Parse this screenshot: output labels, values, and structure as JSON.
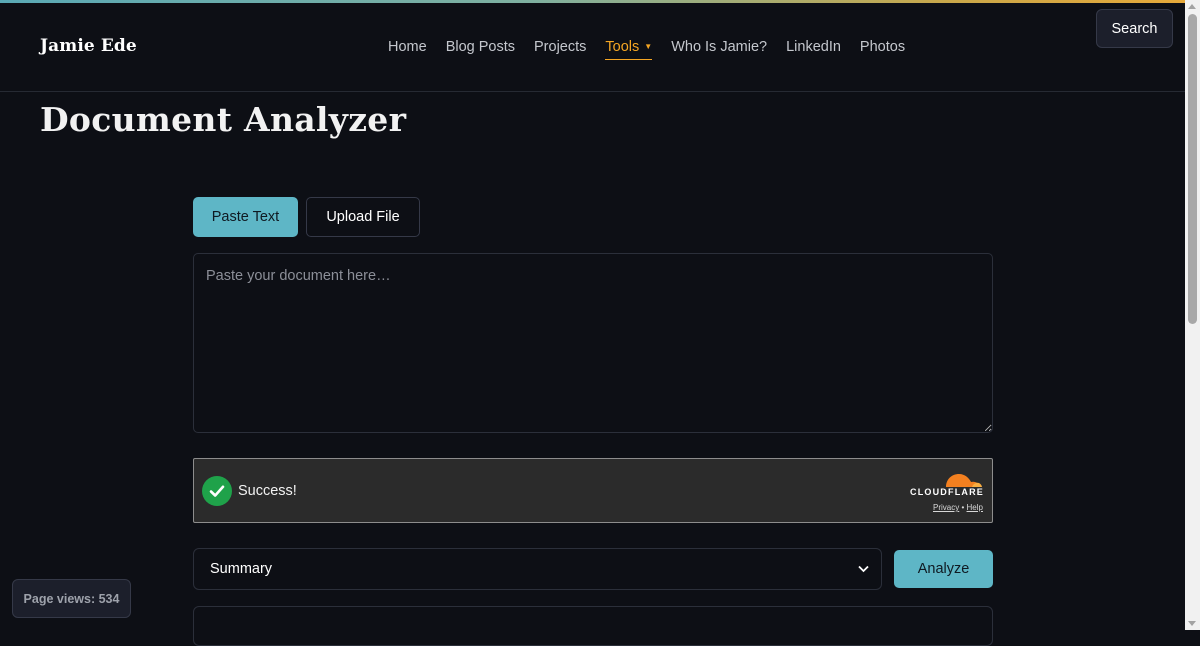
{
  "site": {
    "brand": "Jamie Ede",
    "nav": [
      {
        "label": "Home"
      },
      {
        "label": "Blog Posts"
      },
      {
        "label": "Projects"
      },
      {
        "label": "Tools",
        "active": true
      },
      {
        "label": "Who Is Jamie?"
      },
      {
        "label": "LinkedIn"
      },
      {
        "label": "Photos"
      }
    ],
    "search_label": "Search",
    "accent_color": "#f5a623"
  },
  "page": {
    "title": "Document Analyzer",
    "tabs": [
      {
        "label": "Paste Text",
        "selected": true
      },
      {
        "label": "Upload File",
        "selected": false
      }
    ],
    "textarea": {
      "placeholder": "Paste your document here…",
      "value": ""
    },
    "captcha": {
      "status": "Success!",
      "provider": "CLOUDFLARE",
      "privacy_link": "Privacy",
      "separator": "•",
      "help_link": "Help"
    },
    "analysis_select": {
      "selected": "Summary"
    },
    "analyze_label": "Analyze",
    "button_color": "#5eb6c6"
  },
  "footer": {
    "page_views": "Page views: 534"
  }
}
